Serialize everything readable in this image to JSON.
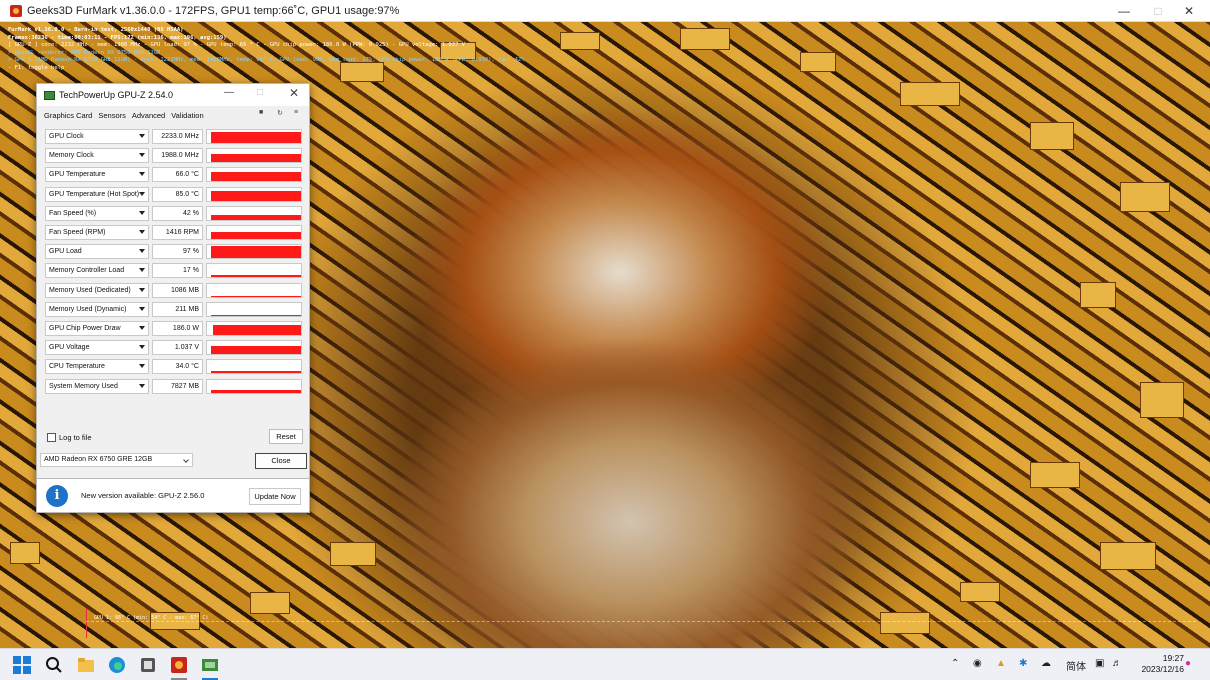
{
  "furmark": {
    "title": "Geeks3D FurMark v1.36.0.0 - 172FPS, GPU1 temp:66˚C, GPU1 usage:97%",
    "osd": {
      "line1": "FurMark v1.36.0.0 - Burn-in test, 2560x1440 (8X MSAA)",
      "line2": "Frames:30236 - time:00:03:11 - FPS:172 (min:136, max:196, avg:159)",
      "line3": "[ GPU-Z ] core: 2232 MHz - mem: 1988 MHz - GPU load: 97 % - GPU temp: 66 ° C - GPU chip power: 186.0 W (PPW: 0.925) - GPU voltage: 1.037 V",
      "line4": "> OpenGL renderer: AMD Radeon RX 6750 GRE 12GB",
      "line5": "> GPU 1 (AMD Radeon RX 6750 GRE 12GB) - core: 2221MHz, mem: 1988MHz, temp: 66° C, GPU load: 98%, mem load: 17%, GPU chip power: 185 W (PPW: 0.930), fan: 42%",
      "line6": "- F1: toggle help"
    },
    "graph_label": "GPU 1: 66° C (min: 54° C - max: 67° C)"
  },
  "gpuz": {
    "title": "TechPowerUp GPU-Z 2.54.0",
    "tabs": [
      "Graphics Card",
      "Sensors",
      "Advanced",
      "Validation"
    ],
    "sensors": [
      {
        "name": "GPU Clock",
        "value": "2233.0 MHz",
        "level": 0.85
      },
      {
        "name": "Memory Clock",
        "value": "1988.0 MHz",
        "level": 0.65
      },
      {
        "name": "GPU Temperature",
        "value": "66.0 °C",
        "level": 0.7
      },
      {
        "name": "GPU Temperature (Hot Spot)",
        "value": "85.0 °C",
        "level": 0.75
      },
      {
        "name": "Fan Speed (%)",
        "value": "42 %",
        "level": 0.4
      },
      {
        "name": "Fan Speed (RPM)",
        "value": "1416 RPM",
        "level": 0.55
      },
      {
        "name": "GPU Load",
        "value": "97 %",
        "level": 0.95
      },
      {
        "name": "Memory Controller Load",
        "value": "17 %",
        "level": 0.15
      },
      {
        "name": "Memory Used (Dedicated)",
        "value": "1086 MB",
        "level": 0.1
      },
      {
        "name": "Memory Used (Dynamic)",
        "value": "211 MB",
        "level": 0.0
      },
      {
        "name": "GPU Chip Power Draw",
        "value": "186.0 W",
        "level": 0.8
      },
      {
        "name": "GPU Voltage",
        "value": "1.037 V",
        "level": 0.6
      },
      {
        "name": "CPU Temperature",
        "value": "34.0 °C",
        "level": 0.12
      },
      {
        "name": "System Memory Used",
        "value": "7827 MB",
        "level": 0.25
      }
    ],
    "log_label": "Log to file",
    "reset_label": "Reset",
    "gpu_select": "AMD Radeon RX 6750 GRE 12GB",
    "close_label": "Close"
  },
  "update": {
    "message": "New version available: GPU-Z 2.56.0",
    "button": "Update Now"
  },
  "taskbar": {
    "ime": "简体",
    "time": "19:27",
    "date": "2023/12/16"
  },
  "colors": {
    "graph_red": "#ff1a1a",
    "info_blue": "#1e72c8"
  }
}
